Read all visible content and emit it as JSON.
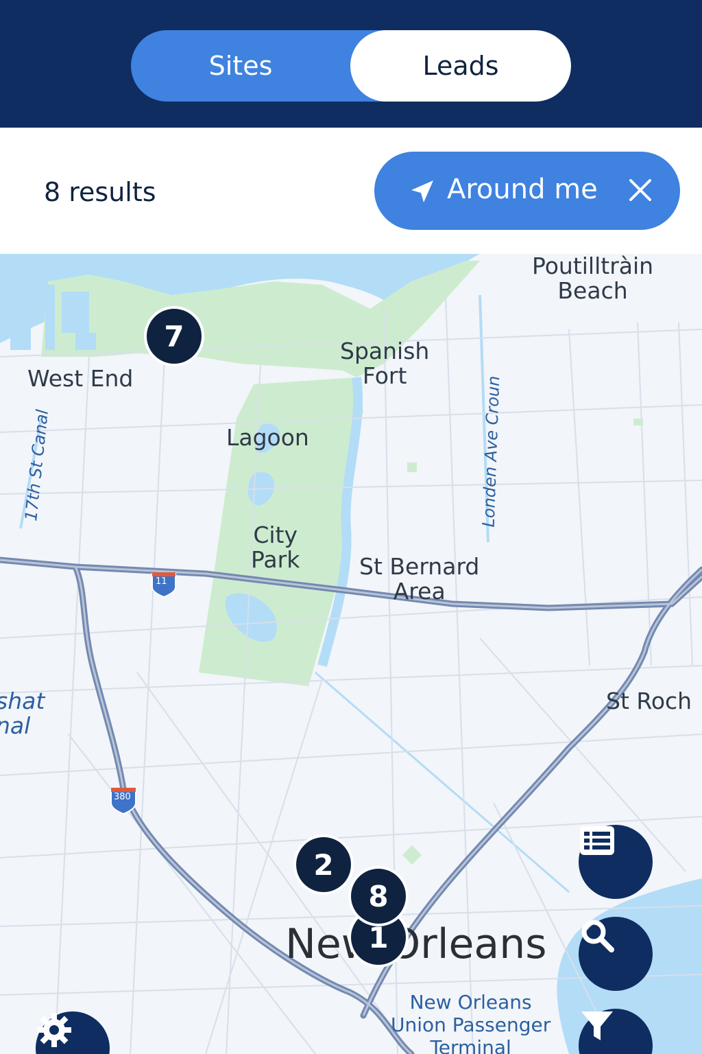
{
  "header": {
    "tabs": [
      {
        "label": "Sites",
        "selected": false
      },
      {
        "label": "Leads",
        "selected": true
      }
    ]
  },
  "filters": {
    "results_text": "8 results",
    "around_me": {
      "label": "Around me",
      "icon": "navigation-arrow-icon",
      "clear_icon": "close-icon"
    }
  },
  "map": {
    "labels": {
      "pontchartrain": "Poutilltràin\nBeach",
      "west_end": "West End",
      "spanish_fort": "Spanish\nFort",
      "lagoon": "Lagoon",
      "canal_17th": "17th St Canal",
      "london_ave": "Londen Ave Croun",
      "city_park": "City\nPark",
      "st_bernard": "St Bernard\nArea",
      "st_roch": "St Roch",
      "industrial": "shat\nnal",
      "new_orleans": "New Orleans",
      "union_terminal": "New Orleans\nUnion Passenger\nTerminal",
      "shield_i10": "11",
      "shield_i610": "380"
    },
    "clusters": [
      {
        "count": "7"
      },
      {
        "count": "2"
      },
      {
        "count": "8"
      },
      {
        "count": "1"
      }
    ]
  },
  "controls": {
    "list_icon": "list-view-icon",
    "search_icon": "search-icon",
    "filter_icon": "filter-icon",
    "settings_icon": "gear-icon"
  },
  "colors": {
    "header_bg": "#0f2d60",
    "accent": "#3f82e0",
    "marker": "#0f2340",
    "water": "#b3dcf7",
    "park": "#cdeccf"
  }
}
